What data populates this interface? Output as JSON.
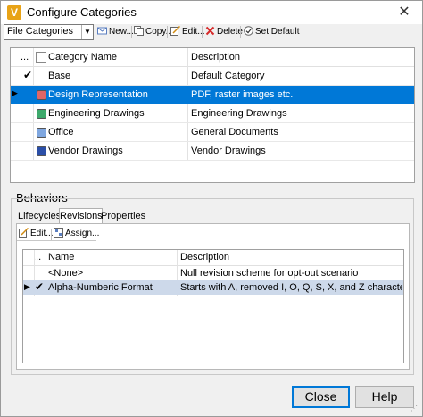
{
  "window": {
    "title": "Configure Categories",
    "close_glyph": "✕"
  },
  "toolbar": {
    "combo_value": "File Categories",
    "new_label": "New...",
    "copy_label": "Copy...",
    "edit_label": "Edit...",
    "delete_label": "Delete",
    "set_default_label": "Set Default"
  },
  "categories": {
    "headers": {
      "dots": "...",
      "name": "Category Name",
      "description": "Description"
    },
    "rows": [
      {
        "name": "Base",
        "description": "Default Category",
        "color": "",
        "checked": true,
        "selected": false,
        "current": false
      },
      {
        "name": "Design Representation",
        "description": "PDF, raster images etc.",
        "color": "#e06666",
        "checked": false,
        "selected": true,
        "current": true
      },
      {
        "name": "Engineering Drawings",
        "description": "Engineering Drawings",
        "color": "#3daa6c",
        "checked": false,
        "selected": false,
        "current": false
      },
      {
        "name": "Office",
        "description": "General Documents",
        "color": "#7fa7e0",
        "checked": false,
        "selected": false,
        "current": false
      },
      {
        "name": "Vendor Drawings",
        "description": "Vendor Drawings",
        "color": "#2b4fa8",
        "checked": false,
        "selected": false,
        "current": false
      }
    ],
    "selected_color": "#0078d7"
  },
  "behaviors": {
    "heading": "Behaviors",
    "tabs": [
      "Lifecycles",
      "Revisions",
      "Properties"
    ],
    "active_tab": "Revisions",
    "edit_label": "Edit...",
    "assign_label": "Assign...",
    "headers": {
      "dots": "...",
      "name": "Name",
      "description": "Description"
    },
    "rows": [
      {
        "name": "<None>",
        "description": "Null revision scheme for opt-out scenario",
        "checked": false,
        "current": false
      },
      {
        "name": "Alpha-Numberic Format",
        "description": "Starts with A, removed I, O, Q, S, X, and Z characters, co...",
        "checked": true,
        "current": true
      }
    ],
    "selected_row_color": "#cdd9ea"
  },
  "footer": {
    "close_label": "Close",
    "help_label": "Help"
  }
}
